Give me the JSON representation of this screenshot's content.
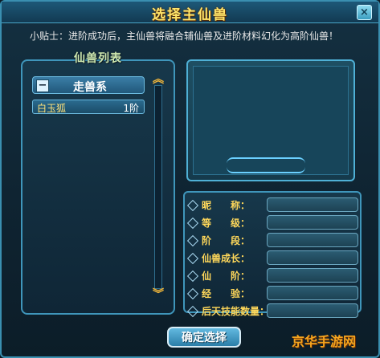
{
  "window": {
    "title": "选择主仙兽",
    "close_label": "×"
  },
  "tip": "小贴士：进阶成功后，主仙兽将融合辅仙兽及进阶材料幻化为高阶仙兽！",
  "list_panel": {
    "title": "仙兽列表",
    "group_label": "走兽系",
    "group_toggle": "−",
    "items": [
      {
        "name": "白玉狐",
        "level": "1阶"
      }
    ],
    "scroll_up": "︽",
    "scroll_down": "︾"
  },
  "attributes": {
    "labels": [
      "昵　　称：",
      "等　　级：",
      "阶　　段：",
      "仙兽成长：",
      "仙　　阶：",
      "经　　验：",
      "后天技能数量："
    ]
  },
  "confirm_button": "确定选择",
  "watermark": "京华手游网"
}
